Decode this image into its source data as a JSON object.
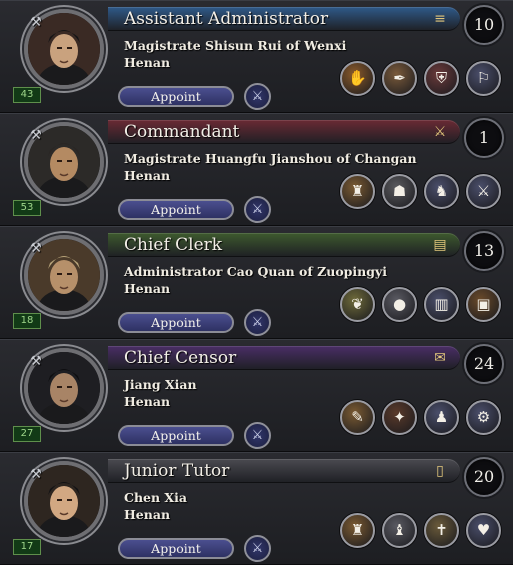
{
  "cards": [
    {
      "title": "Assistant Administrator",
      "header_icon": "scroll-icon",
      "header_glyph": "≡",
      "count": "10",
      "name": "Magistrate Shisun Rui of Wenxi",
      "province": "Henan",
      "level": "43",
      "appoint_label": "Appoint",
      "header_color": "#2f5a8a",
      "actions": [
        {
          "icon": "handshake-icon",
          "glyph": "✋",
          "bg": "#8a5a2a"
        },
        {
          "icon": "quill-icon",
          "glyph": "✒",
          "bg": "#7a5a3a"
        },
        {
          "icon": "shield-icon",
          "glyph": "⛨",
          "bg": "#6a3a3a"
        },
        {
          "icon": "running-figure-icon",
          "glyph": "⚐",
          "bg": "#4a4e6a"
        }
      ]
    },
    {
      "title": "Commandant",
      "header_icon": "crossed-swords-icon",
      "header_glyph": "⚔",
      "count": "1",
      "name": "Magistrate Huangfu Jianshou of Changan",
      "province": "Henan",
      "level": "53",
      "appoint_label": "Appoint",
      "header_color": "#6a2a34",
      "actions": [
        {
          "icon": "soldier-icon",
          "glyph": "♜",
          "bg": "#7a5a32"
        },
        {
          "icon": "helmet-icon",
          "glyph": "☗",
          "bg": "#5a5a5e"
        },
        {
          "icon": "warrior-icon",
          "glyph": "♞",
          "bg": "#4a4e6a"
        },
        {
          "icon": "sword-icon",
          "glyph": "⚔",
          "bg": "#4a4e6a"
        }
      ]
    },
    {
      "title": "Chief Clerk",
      "header_icon": "treasure-chest-icon",
      "header_glyph": "▤",
      "count": "13",
      "name": "Administrator Cao Quan of Zuopingyi",
      "province": "Henan",
      "level": "18",
      "appoint_label": "Appoint",
      "header_color": "#3e5a2e",
      "actions": [
        {
          "icon": "land-icon",
          "glyph": "❦",
          "bg": "#6e6a3a"
        },
        {
          "icon": "coins-icon",
          "glyph": "●",
          "bg": "#5a5a62"
        },
        {
          "icon": "buildings-icon",
          "glyph": "▥",
          "bg": "#4a4e6a"
        },
        {
          "icon": "chest-icon",
          "glyph": "▣",
          "bg": "#6a4a2a"
        }
      ]
    },
    {
      "title": "Chief Censor",
      "header_icon": "letter-dagger-icon",
      "header_glyph": "✉",
      "count": "24",
      "name": "Jiang Xian",
      "province": "Henan",
      "level": "27",
      "appoint_label": "Appoint",
      "header_color": "#4a2e66",
      "actions": [
        {
          "icon": "scroll-quill-icon",
          "glyph": "✎",
          "bg": "#7a5a32"
        },
        {
          "icon": "torch-icon",
          "glyph": "✦",
          "bg": "#5a3a2a"
        },
        {
          "icon": "hooded-figure-icon",
          "glyph": "♟",
          "bg": "#4a4e6a"
        },
        {
          "icon": "gear-icon",
          "glyph": "⚙",
          "bg": "#4a4e6a"
        }
      ]
    },
    {
      "title": "Junior Tutor",
      "header_icon": "open-book-icon",
      "header_glyph": "▯",
      "count": "20",
      "name": "Chen Xia",
      "province": "Henan",
      "level": "17",
      "appoint_label": "Appoint",
      "header_color": "#4a4a50",
      "actions": [
        {
          "icon": "temple-icon",
          "glyph": "♜",
          "bg": "#7a5a32"
        },
        {
          "icon": "monk-icon",
          "glyph": "♝",
          "bg": "#5a5a62"
        },
        {
          "icon": "holy-book-icon",
          "glyph": "✝",
          "bg": "#6a5a3a"
        },
        {
          "icon": "cross-heart-icon",
          "glyph": "♥",
          "bg": "#4a4e6a"
        }
      ]
    }
  ]
}
